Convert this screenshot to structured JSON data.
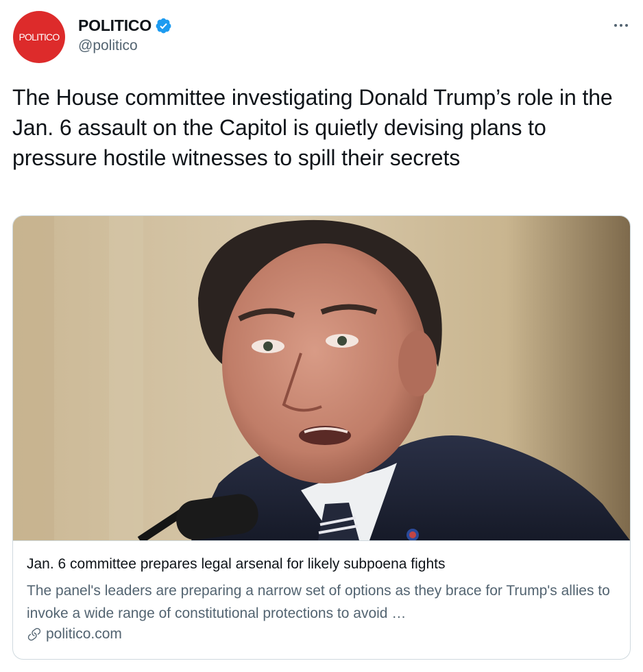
{
  "account": {
    "avatar_text": "POLITICO",
    "display_name": "POLITICO",
    "handle": "@politico",
    "verified": true
  },
  "tweet": {
    "text": "The House committee investigating Donald Trump’s role in the Jan. 6 assault on the Capitol is quietly devising plans to pressure hostile witnesses to spill their secrets"
  },
  "card": {
    "image_icon": "photo-of-man-speaking-at-microphone",
    "title": "Jan. 6 committee prepares legal arsenal for likely subpoena fights",
    "description": "The panel's leaders are preparing a narrow set of options as they brace for Trump's allies to invoke a wide range of constitutional protections to avoid …",
    "domain": "politico.com"
  },
  "icons": {
    "verified": "verified-badge-icon",
    "more": "more-options-icon",
    "link": "link-icon"
  },
  "colors": {
    "brand": "#dd2b2b",
    "verified": "#1d9bf0",
    "secondary_text": "#536471",
    "border": "#cfd9de"
  }
}
